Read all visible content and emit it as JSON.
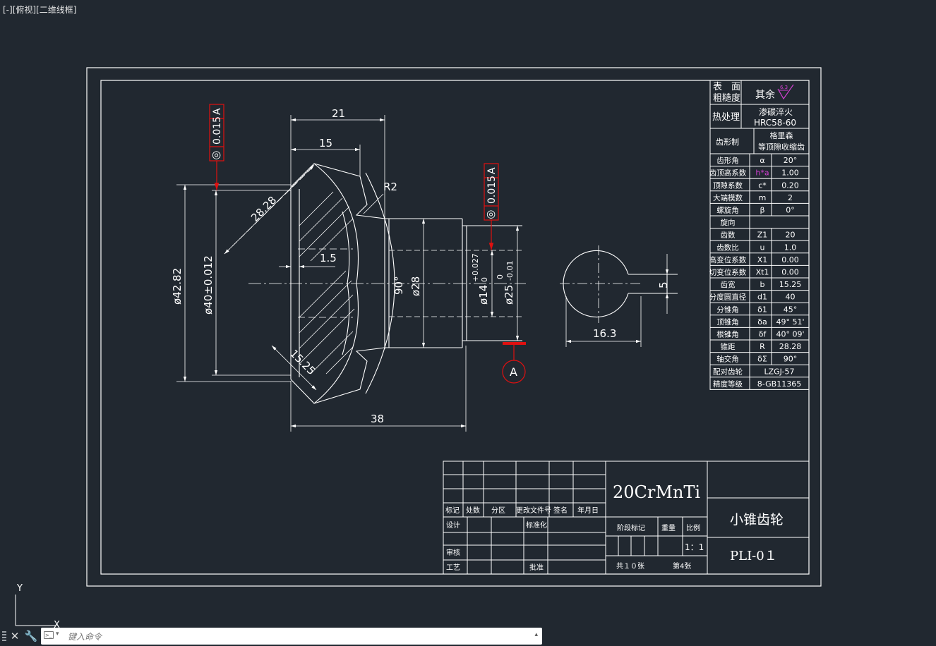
{
  "viewport_label": "[-][俯视][二维线框]",
  "ucs": {
    "y_label": "Y",
    "x_label": "X"
  },
  "command_line": {
    "placeholder": "键入命令",
    "value": ""
  },
  "drawing": {
    "tolerance_left": {
      "symbol": "◎",
      "value": "0.015",
      "datum": "A"
    },
    "tolerance_right": {
      "symbol": "◎",
      "value": "0.015",
      "datum": "A"
    },
    "datum_label": "A",
    "dims": {
      "d21": "21",
      "d15": "15",
      "r2": "R2",
      "d2828": "28.28",
      "d15b": "1.5",
      "d4282": "ø42.82",
      "d40": "ø40±0.012",
      "a90": "90°",
      "d28": "ø28",
      "d14": "ø14",
      "d14tol_u": "+0.027",
      "d14tol_l": "0",
      "d25": "ø25",
      "d25tol_u": "0",
      "d25tol_l": "-0.01",
      "d1525": "15.25",
      "d38": "38",
      "d163": "16.3",
      "d5": "5"
    }
  },
  "surface_table": {
    "row1_label_a": "表　面",
    "row1_label_b": "粗糙度",
    "row1_value": "其余",
    "roughness_value": "6.3",
    "row2_label": "热处理",
    "row2_value_a": "渗碳淬火",
    "row2_value_b": "HRC58-60"
  },
  "gear_table": {
    "head_label": "齿形制",
    "head_value_a": "格里森",
    "head_value_b": "等顶隙收缩齿",
    "rows": [
      {
        "name": "齿形角",
        "sym": "α",
        "val": "20°"
      },
      {
        "name": "齿顶高系数",
        "sym": "h*a",
        "val": "1.00"
      },
      {
        "name": "顶隙系数",
        "sym": "c*",
        "val": "0.20"
      },
      {
        "name": "大端模数",
        "sym": "m",
        "val": "2"
      },
      {
        "name": "螺旋角",
        "sym": "β",
        "val": "0°"
      },
      {
        "name": "旋向",
        "sym": "",
        "val": ""
      },
      {
        "name": "齿数",
        "sym": "Z1",
        "val": "20"
      },
      {
        "name": "齿数比",
        "sym": "u",
        "val": "1.0"
      },
      {
        "name": "高变位系数",
        "sym": "X1",
        "val": "0.00"
      },
      {
        "name": "切变位系数",
        "sym": "Xt1",
        "val": "0.00"
      },
      {
        "name": "齿宽",
        "sym": "b",
        "val": "15.25"
      },
      {
        "name": "分度圆直径",
        "sym": "d1",
        "val": "40"
      },
      {
        "name": "分锥角",
        "sym": "δ1",
        "val": "45°"
      },
      {
        "name": "顶锥角",
        "sym": "δa",
        "val": "49° 51'"
      },
      {
        "name": "根锥角",
        "sym": "δf",
        "val": "40° 09'"
      },
      {
        "name": "锥距",
        "sym": "R",
        "val": "28.28"
      },
      {
        "name": "轴交角",
        "sym": "δΣ",
        "val": "90°"
      },
      {
        "name": "配对齿轮",
        "sym": "",
        "val": "LZGJ-57"
      },
      {
        "name": "精度等级",
        "sym": "",
        "val": "8-GB11365"
      }
    ]
  },
  "title_block": {
    "headers": [
      "标记",
      "处数",
      "分区",
      "更改文件号",
      "签名",
      "年月日"
    ],
    "design": "设计",
    "standardize": "标准化",
    "review": "审核",
    "process": "工艺",
    "approve": "批准",
    "material": "20CrMnTi",
    "part_name": "小锥齿轮",
    "stage_mark": "阶段标记",
    "weight": "重量",
    "scale_label": "比例",
    "scale_value": "1：1",
    "total_sheets": "共１０张",
    "sheet_no": "第4张",
    "drawing_no": "PLI-0１"
  }
}
